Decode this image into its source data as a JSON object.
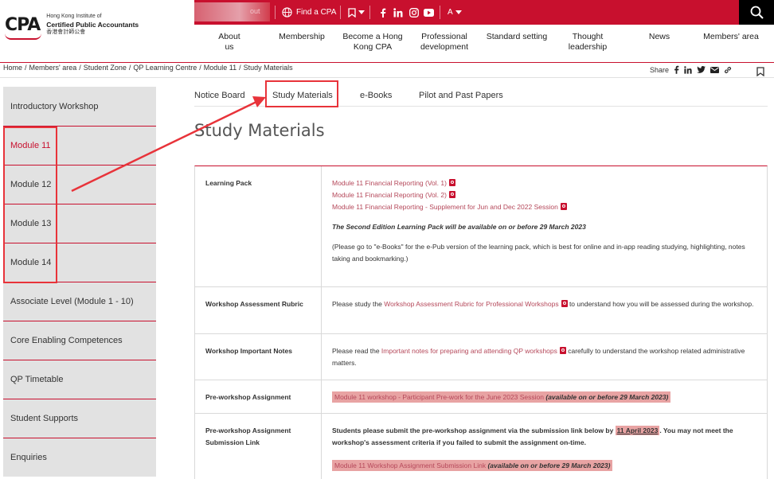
{
  "logo": {
    "mark": "CPA",
    "line1": "Hong Kong Institute of",
    "line2": "Certified Public Accountants",
    "line3": "香港會計師公會"
  },
  "topbar": {
    "blurred_text": "out",
    "find_cpa": "Find a CPA",
    "font_size_label": "A"
  },
  "nav": [
    "About us",
    "Membership",
    "Become a Hong Kong CPA",
    "Professional development",
    "Standard setting",
    "Thought leadership",
    "News",
    "Members' area"
  ],
  "breadcrumb": [
    "Home",
    "Members' area",
    "Student Zone",
    "QP Learning Centre",
    "Module 11",
    "Study Materials"
  ],
  "share_label": "Share",
  "sidebar": [
    "Introductory Workshop",
    "Module 11",
    "Module 12",
    "Module 13",
    "Module 14",
    "Associate Level (Module 1 - 10)",
    "Core Enabling Competences",
    "QP Timetable",
    "Student Supports",
    "Enquiries"
  ],
  "tabs": [
    "Notice Board",
    "Study Materials",
    "e-Books",
    "Pilot and Past Papers"
  ],
  "page_title": "Study Materials",
  "table": {
    "learning_pack": {
      "label": "Learning Pack",
      "link1": "Module 11 Financial Reporting (Vol. 1)",
      "link2": "Module 11 Financial Reporting (Vol. 2)",
      "link3": "Module 11 Financial Reporting - Supplement for Jun and Dec 2022 Session",
      "note": "The Second Edition Learning Pack will be available on or before 29 March 2023",
      "paren": "(Please go to \"e-Books\" for the e-Pub version of the learning pack, which is best for online and in-app reading studying, highlighting, notes taking and bookmarking.)"
    },
    "rubric": {
      "label": "Workshop Assessment Rubric",
      "pre": "Please study the ",
      "link": "Workshop Assessment Rubric for Professional Workshops",
      "post": " to understand how you will be assessed during the workshop."
    },
    "notes": {
      "label": "Workshop Important Notes",
      "pre": "Please read the ",
      "link": "Important notes for preparing and attending QP workshops",
      "post": " carefully to understand the workshop related administrative matters."
    },
    "pre_assignment": {
      "label": "Pre-workshop Assignment",
      "link": "Module 11 workshop - Participant Pre-work for the June 2023 Session",
      "avail": " (available on or before 29 March 2023)"
    },
    "submission": {
      "label": "Pre-workshop Assignment Submission Link",
      "text_pre": "Students please submit the pre-workshop assignment via the submission link below by ",
      "date": "11 April 2023",
      "text_post": ". You may not meet the workshop's assessment criteria if you failed to submit the assignment on-time.",
      "link": "Module 11 Workshop Assignment Submission Link",
      "avail": " (available on or before 29 March 2023)"
    }
  }
}
